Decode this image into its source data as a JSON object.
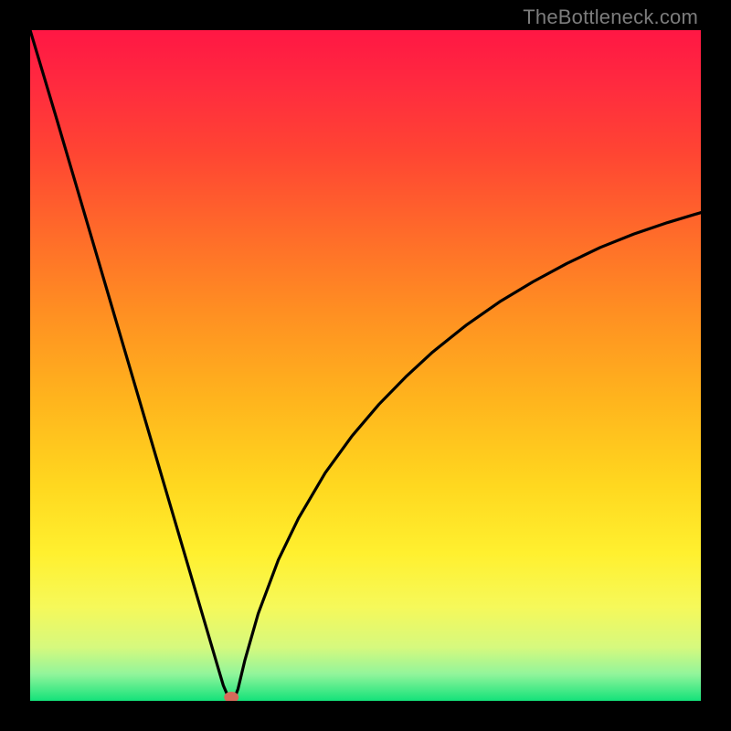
{
  "watermark": {
    "text": "TheBottleneck.com"
  },
  "chart_data": {
    "type": "line",
    "title": "",
    "xlabel": "",
    "ylabel": "",
    "xlim": [
      0,
      100
    ],
    "ylim": [
      0,
      100
    ],
    "grid": false,
    "legend": false,
    "background_gradient": {
      "stops": [
        {
          "offset": 0.0,
          "color": "#ff1744"
        },
        {
          "offset": 0.08,
          "color": "#ff2a3f"
        },
        {
          "offset": 0.18,
          "color": "#ff4433"
        },
        {
          "offset": 0.3,
          "color": "#ff6a2a"
        },
        {
          "offset": 0.42,
          "color": "#ff8f22"
        },
        {
          "offset": 0.55,
          "color": "#ffb41d"
        },
        {
          "offset": 0.68,
          "color": "#ffd81f"
        },
        {
          "offset": 0.78,
          "color": "#fff02f"
        },
        {
          "offset": 0.86,
          "color": "#f6f95a"
        },
        {
          "offset": 0.92,
          "color": "#d6f97e"
        },
        {
          "offset": 0.96,
          "color": "#92f59b"
        },
        {
          "offset": 1.0,
          "color": "#14e27a"
        }
      ]
    },
    "series": [
      {
        "name": "bottleneck-curve",
        "color": "#000000",
        "x": [
          0,
          2,
          4,
          6,
          8,
          10,
          12,
          14,
          16,
          18,
          20,
          22,
          24,
          25.5,
          27,
          28,
          28.8,
          29.4,
          29.8,
          30,
          30.4,
          31,
          32,
          34,
          37,
          40,
          44,
          48,
          52,
          56,
          60,
          65,
          70,
          75,
          80,
          85,
          90,
          95,
          100
        ],
        "y": [
          100,
          93.3,
          86.6,
          79.8,
          73.0,
          66.2,
          59.4,
          52.6,
          45.8,
          39.0,
          32.2,
          25.4,
          18.6,
          13.5,
          8.4,
          5.0,
          2.3,
          0.9,
          0.2,
          0.0,
          0.2,
          1.8,
          6.0,
          13.0,
          21.0,
          27.2,
          34.0,
          39.5,
          44.2,
          48.3,
          52.0,
          56.0,
          59.5,
          62.5,
          65.2,
          67.6,
          69.6,
          71.3,
          72.8
        ]
      }
    ],
    "marker": {
      "name": "optimum-point",
      "x": 30,
      "y": 0,
      "color": "#d66a5a"
    }
  }
}
